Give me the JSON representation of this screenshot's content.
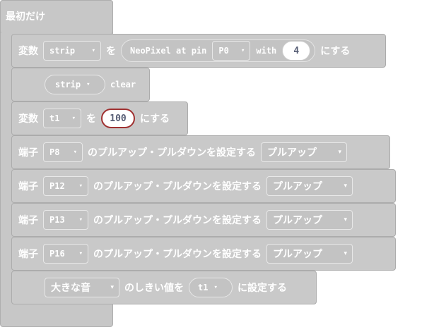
{
  "hat": {
    "label": "最初だけ"
  },
  "rows": {
    "strip_set": {
      "var_label": "変数",
      "var": "strip",
      "wo": "を",
      "call": "NeoPixel at pin",
      "pin": "P0",
      "with": "with",
      "count": "4",
      "suru": "にする"
    },
    "strip_clear": {
      "var": "strip",
      "action": "clear"
    },
    "t1_set": {
      "var_label": "変数",
      "var": "t1",
      "wo": "を",
      "value": "100",
      "suru": "にする"
    },
    "pull": [
      {
        "prefix": "端子",
        "pin": "P8",
        "text": "のプルアップ・プルダウンを設定する",
        "mode": "プルアップ"
      },
      {
        "prefix": "端子",
        "pin": "P12",
        "text": "のプルアップ・プルダウンを設定する",
        "mode": "プルアップ"
      },
      {
        "prefix": "端子",
        "pin": "P13",
        "text": "のプルアップ・プルダウンを設定する",
        "mode": "プルアップ"
      },
      {
        "prefix": "端子",
        "pin": "P16",
        "text": "のプルアップ・プルダウンを設定する",
        "mode": "プルアップ"
      }
    ],
    "threshold": {
      "sound": "大きな音",
      "mid": "のしきい値を",
      "var": "t1",
      "end": "に設定する"
    }
  },
  "icons": {
    "dropdown": "▾"
  },
  "colors": {
    "block": "#c7c7c7",
    "block_border": "#aeaeae",
    "input": "#ffffff",
    "input_text": "#575e75"
  }
}
